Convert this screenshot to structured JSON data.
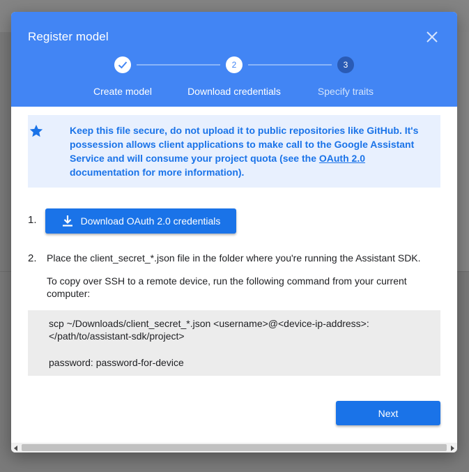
{
  "dialog": {
    "title": "Register model",
    "steps": [
      {
        "number": "1",
        "label": "Create model",
        "status": "done"
      },
      {
        "number": "2",
        "label": "Download credentials",
        "status": "current"
      },
      {
        "number": "3",
        "label": "Specify traits",
        "status": "upcoming"
      }
    ]
  },
  "info": {
    "text_before": "Keep this file secure, do not upload it to public repositories like GitHub. It's possession allows client applications to make call to the Google Assistant Service and will consume your project quota (see the ",
    "link": "OAuth 2.0",
    "text_after": " documentation for more information)."
  },
  "instructions": {
    "step1_number": "1.",
    "download_button": "Download OAuth 2.0 credentials",
    "step2_number": "2.",
    "step2_text": "Place the client_secret_*.json file in the folder where you're running the Assistant SDK.",
    "ssh_text": "To copy over SSH to a remote device, run the following command from your current computer:",
    "code_line1": "scp ~/Downloads/client_secret_*.json <username>@<device-ip-address>:",
    "code_line2": "</path/to/assistant-sdk/project>",
    "code_line3": "password: password-for-device"
  },
  "footer": {
    "next_button": "Next"
  },
  "icons": {
    "close": "close-icon",
    "check": "checkmark-icon",
    "star": "star-icon",
    "download": "download-icon"
  },
  "colors": {
    "header": "#4285f4",
    "primary_button": "#1a73e8",
    "info_background": "#e8f0fe",
    "info_text": "#1a73e8"
  }
}
